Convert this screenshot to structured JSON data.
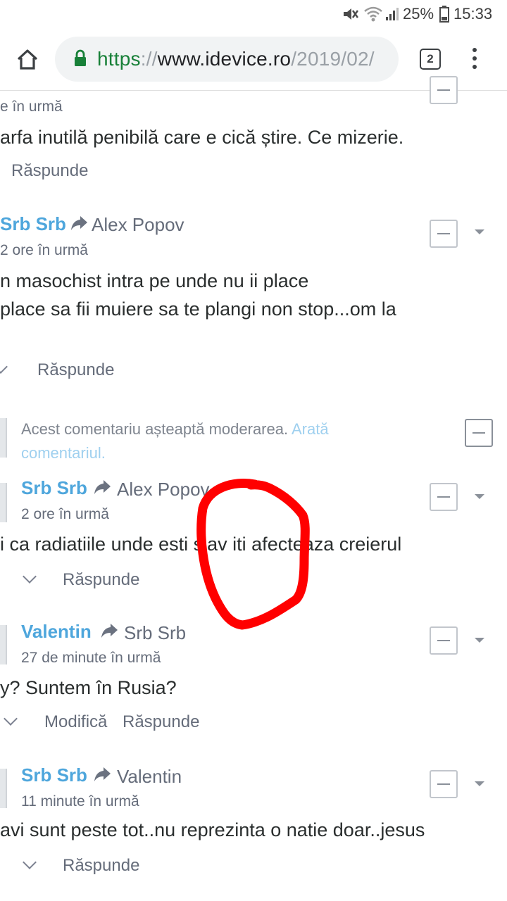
{
  "status_bar": {
    "battery": "25%",
    "time": "15:33"
  },
  "browser": {
    "url_scheme": "https",
    "url_sep": "://",
    "url_host": "www.idevice.ro",
    "url_path": "/2019/02/",
    "tab_count": "2"
  },
  "comments": [
    {
      "time": "e în urmă",
      "body": [
        "arfa inutilă penibilă care e cică știre. Ce mizerie."
      ],
      "actions": [
        "Răspunde"
      ]
    },
    {
      "author": "Srb Srb",
      "reply_to": "Alex Popov",
      "time": "2 ore în urmă",
      "body": [
        "n masochist intra pe unde nu ii place",
        " place sa fii muiere sa te plangi non stop...om la"
      ],
      "actions": [
        "Răspunde"
      ]
    },
    {
      "moderation_text": "Acest comentariu așteaptă moderarea.",
      "moderation_link_1": "Arată",
      "moderation_link_2": "comentariul."
    },
    {
      "author": "Srb Srb",
      "reply_to": "Alex Popov",
      "time": "2 ore în urmă",
      "body": [
        "i ca radiatiile unde esti slav iti afecteaza creierul"
      ],
      "actions": [
        "Răspunde"
      ]
    },
    {
      "author": "Valentin",
      "reply_to": "Srb Srb",
      "time": "27 de minute în urmă",
      "body": [
        "y? Suntem în Rusia?"
      ],
      "actions": [
        "Modifică",
        "Răspunde"
      ]
    },
    {
      "author": "Srb Srb",
      "reply_to": "Valentin",
      "time": "11 minute în urmă",
      "body": [
        "avi sunt peste tot..nu reprezinta o natie doar..jesus"
      ],
      "actions": [
        "Răspunde"
      ]
    }
  ],
  "annotation": {
    "color": "#ff0000"
  }
}
